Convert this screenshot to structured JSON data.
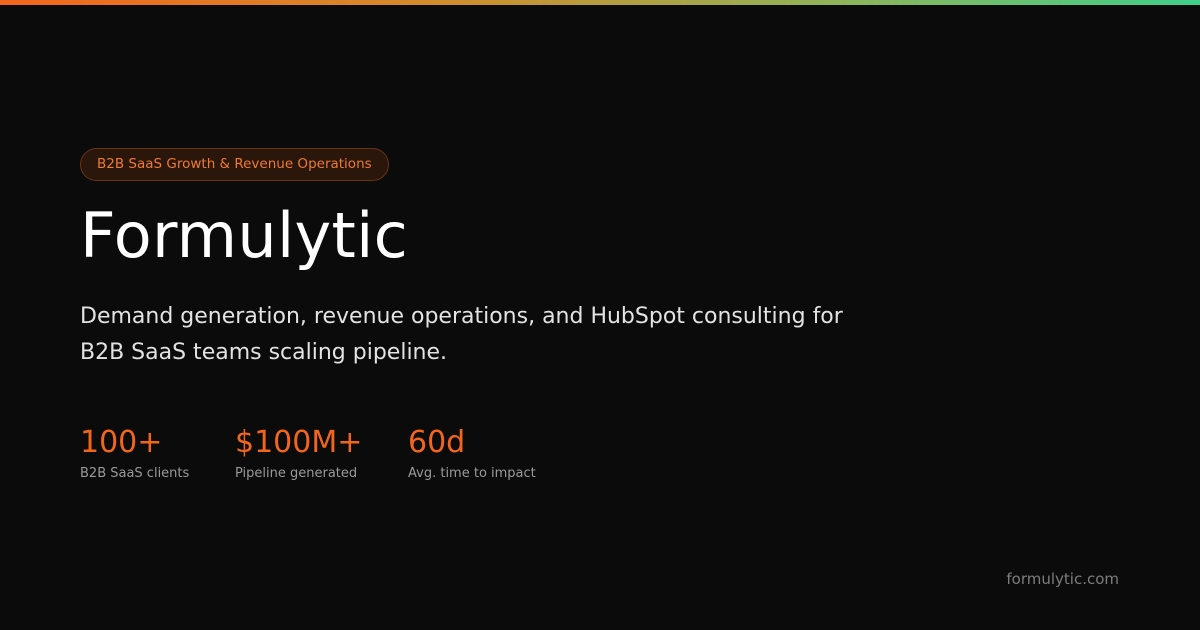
{
  "theme": {
    "background": "#0b0b0b",
    "accent": "#f2661c",
    "gradient": [
      "#f2661c",
      "#d58b2a",
      "#8fb45a",
      "#3fd08a"
    ]
  },
  "badge": {
    "label": "B2B SaaS Growth & Revenue Operations"
  },
  "hero": {
    "title": "Formulytic",
    "subtitle": "Demand generation, revenue operations, and HubSpot consulting for B2B SaaS teams scaling pipeline."
  },
  "stats": [
    {
      "value": "100+",
      "label": "B2B SaaS clients"
    },
    {
      "value": "$100M+",
      "label": "Pipeline generated"
    },
    {
      "value": "60d",
      "label": "Avg. time to impact"
    }
  ],
  "footer": {
    "domain": "formulytic.com"
  }
}
